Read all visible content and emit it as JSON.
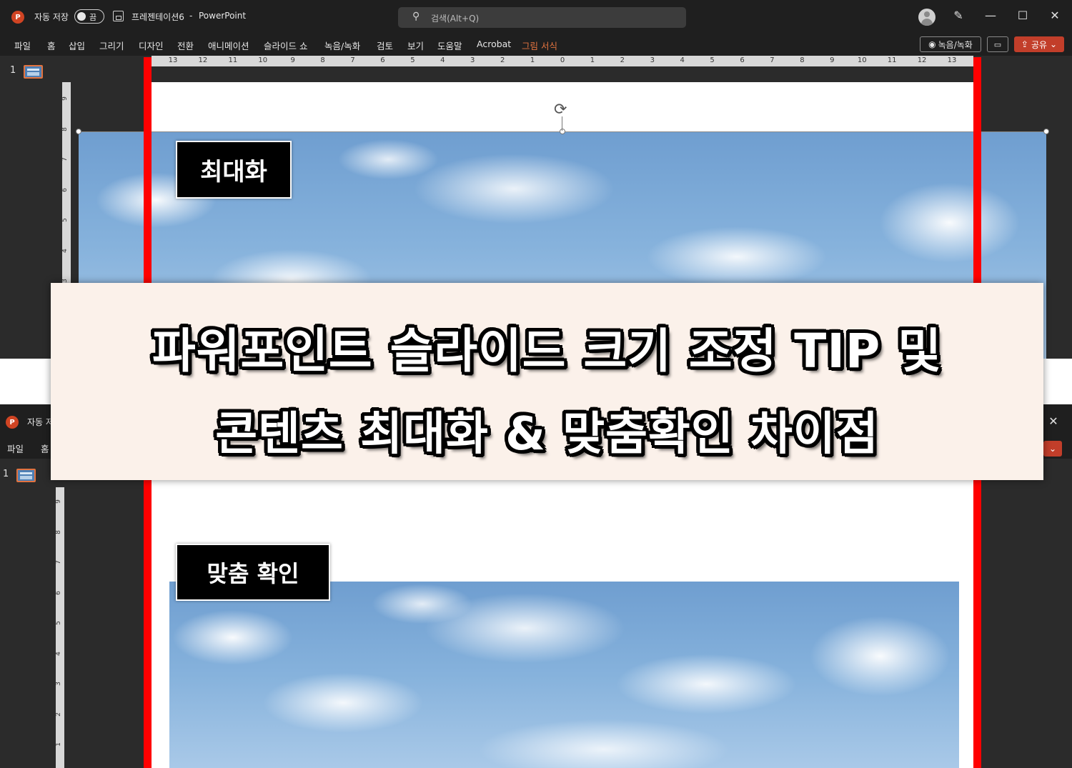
{
  "top_window": {
    "autosave_label": "자동 저장",
    "toggle_state": "끔",
    "doc_title": "프레젠테이션6",
    "title_separator": "-",
    "app_name": "PowerPoint",
    "search_placeholder": "검색(Alt+Q)",
    "menu": [
      "파일",
      "홈",
      "삽입",
      "그리기",
      "디자인",
      "전환",
      "애니메이션",
      "슬라이드 쇼",
      "녹음/녹화",
      "검토",
      "보기",
      "도움말",
      "Acrobat",
      "그림 서식"
    ],
    "record_button": "녹음/녹화",
    "share_button": "공유",
    "slide_number": "1",
    "ruler_ticks": [
      "13",
      "12",
      "11",
      "10",
      "9",
      "8",
      "7",
      "6",
      "5",
      "4",
      "3",
      "2",
      "1",
      "0",
      "1",
      "2",
      "3",
      "4",
      "5",
      "6",
      "7",
      "8",
      "9",
      "10",
      "11",
      "12",
      "13"
    ],
    "vruler_ticks": [
      "9",
      "8",
      "7",
      "6",
      "5",
      "4",
      "3"
    ],
    "label": "최대화"
  },
  "bottom_window": {
    "autosave_label": "자동 저",
    "menu": [
      "파일",
      "홈"
    ],
    "slide_number": "1",
    "vruler_ticks": [
      "9",
      "8",
      "7",
      "6",
      "5",
      "4",
      "3",
      "2",
      "1"
    ],
    "label": "맞춤 확인"
  },
  "banner": {
    "line1": "파워포인트 슬라이드 크기 조정 TIP 및",
    "line2": "콘텐츠 최대화 & 맞춤확인 차이점"
  },
  "colors": {
    "accent_orange": "#e2733f",
    "share_red": "#c23e2a",
    "guide_red": "#ff0000",
    "banner_bg": "#fbf1ea"
  },
  "icons": {
    "app": "powerpoint-logo-icon",
    "save": "save-icon",
    "search": "search-icon",
    "rotate": "rotate-handle-icon"
  }
}
